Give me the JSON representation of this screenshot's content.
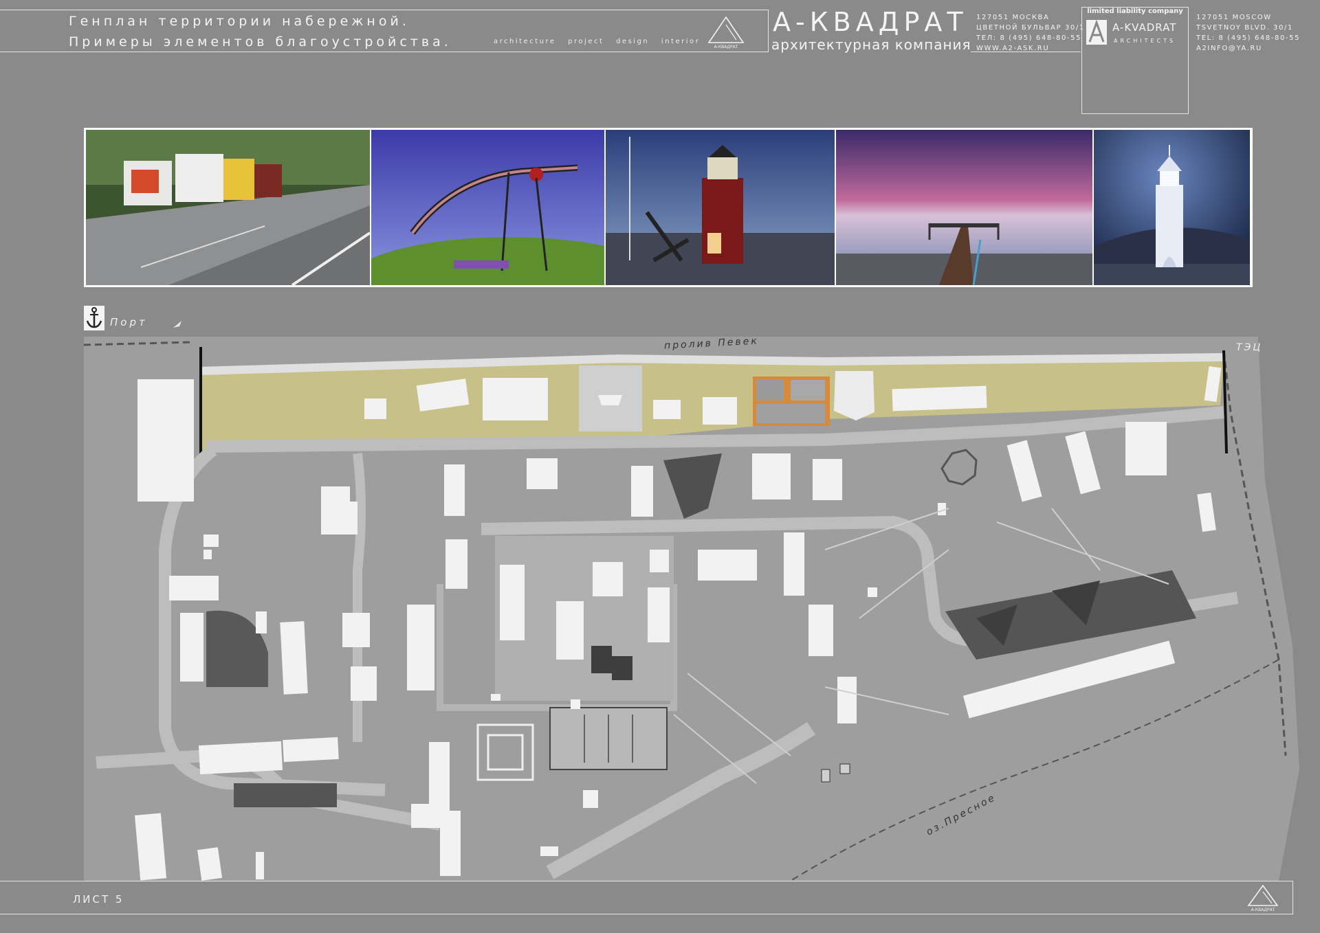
{
  "header": {
    "title_line1": "Генплан территории набережной.",
    "title_line2": "Примеры элементов благоустройства.",
    "tags": "architecture project design interior",
    "logo_small_text": "А-КВАДРАТ",
    "brand_name": "А-КВАДРАТ",
    "brand_sub": "архитектурная компания",
    "address_ru": [
      "127051 МОСКВА",
      "ЦВЕТНОЙ БУЛЬВАР 30/1",
      "ТЕЛ: 8 (495) 648-80-55",
      "WWW.A2-ASK.RU"
    ],
    "llc_title": "limited liability company",
    "llc_name": "A-KVADRAT",
    "llc_arch": "ARCHITECTS",
    "address_en": [
      "127051 MOSCOW",
      "TSVETNOY BLVD. 30/1",
      "TEL: 8 (495) 648-80-55",
      "A2INFO@YA.RU"
    ]
  },
  "map": {
    "port_label": "Порт",
    "strait_label": "пролив Певек",
    "tec_label": "ТЭЦ",
    "lake_label": "оз.Пресное"
  },
  "footer": {
    "sheet_label": "ЛИСТ 5",
    "logo_text": "А-КВАДРАТ"
  },
  "colors": {
    "background": "#8a8a8a",
    "promenade": "#c8c089",
    "building": "#f2f2f2",
    "highlight": "#d58a3c"
  }
}
